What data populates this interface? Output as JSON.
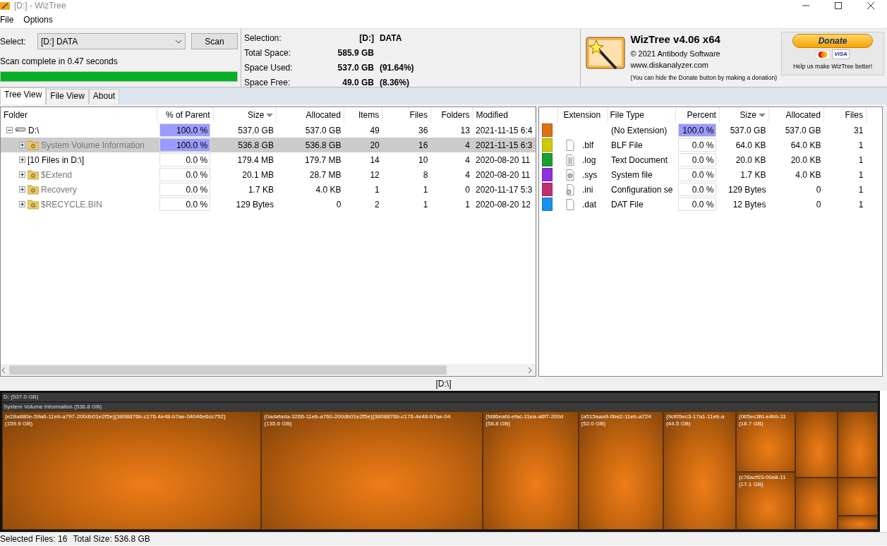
{
  "window": {
    "title": "[D:]  - WizTree"
  },
  "menu": [
    "File",
    "Options"
  ],
  "scan": {
    "select_label": "Select:",
    "drive": "[D:] DATA",
    "button": "Scan",
    "status": "Scan complete in 0.47 seconds",
    "level": 1.0
  },
  "summary": [
    {
      "label": "Selection:",
      "value": "[D:]",
      "extra": "DATA"
    },
    {
      "label": "Total Space:",
      "value": "585.9 GB"
    },
    {
      "label": "Space Used:",
      "value": "537.0 GB",
      "extra": "(91.64%)"
    },
    {
      "label": "Space Free:",
      "value": "49.0 GB",
      "extra": "(8.36%)"
    }
  ],
  "about": {
    "title": "WizTree v4.06 x64",
    "copyright": "© 2021 Antibody Software",
    "url": "www.diskanalyzer.com",
    "hint": "(You can hide the Donate button by making a donation)"
  },
  "donate": {
    "label": "Donate",
    "card_text": "VISA",
    "note": "Help us make WizTree better!"
  },
  "tabs": [
    {
      "label": "Tree View",
      "selected": true
    },
    {
      "label": "File View",
      "selected": false
    },
    {
      "label": "About",
      "selected": false
    }
  ],
  "tree": {
    "columns": [
      {
        "label": "Folder",
        "sorted": false
      },
      {
        "label": "% of Parent",
        "sorted": false
      },
      {
        "label": "Size",
        "sorted": true
      },
      {
        "label": "Allocated",
        "sorted": false
      },
      {
        "label": "Items",
        "sorted": false
      },
      {
        "label": "Files",
        "sorted": false
      },
      {
        "label": "Folders",
        "sorted": false
      },
      {
        "label": "Modified",
        "sorted": false
      }
    ],
    "rows": [
      {
        "kind": "drive",
        "name": "D:\\",
        "expanded": true,
        "system": false,
        "selected": false,
        "percent": "100.0 %",
        "level": 1.0,
        "size": "537.0 GB",
        "allocated": "537.0 GB",
        "items": "49",
        "files": "36",
        "folders": "13",
        "modified": "2021-11-15 6:4",
        "children": [
          {
            "kind": "folder",
            "name": "System Volume Information",
            "expanded": false,
            "system": true,
            "selected": true,
            "percent": "100.0 %",
            "level": 1.0,
            "size": "536.8 GB",
            "allocated": "536.8 GB",
            "items": "20",
            "files": "16",
            "folders": "4",
            "modified": "2021-11-15 6:3"
          },
          {
            "kind": "files",
            "name": "[10 Files in D:\\]",
            "expanded": false,
            "system": false,
            "selected": false,
            "percent": "0.0 %",
            "level": 0.0,
            "size": "179.4 MB",
            "allocated": "179.7 MB",
            "items": "14",
            "files": "10",
            "folders": "4",
            "modified": "2020-08-20 11"
          },
          {
            "kind": "folder",
            "name": "$Extend",
            "expanded": false,
            "system": true,
            "selected": false,
            "percent": "0.0 %",
            "level": 0.0,
            "size": "20.1 MB",
            "allocated": "28.7 MB",
            "items": "12",
            "files": "8",
            "folders": "4",
            "modified": "2020-08-20 11"
          },
          {
            "kind": "folder",
            "name": "Recovery",
            "expanded": false,
            "system": true,
            "selected": false,
            "percent": "0.0 %",
            "level": 0.0,
            "size": "1.7 KB",
            "allocated": "4.0 KB",
            "items": "1",
            "files": "1",
            "folders": "0",
            "modified": "2020-11-17 5:3"
          },
          {
            "kind": "folder",
            "name": "$RECYCLE.BIN",
            "expanded": false,
            "system": true,
            "selected": false,
            "percent": "0.0 %",
            "level": 0.0,
            "size": "129 Bytes",
            "allocated": "0",
            "items": "2",
            "files": "1",
            "folders": "1",
            "modified": "2020-08-20 12"
          }
        ]
      }
    ]
  },
  "extensions": {
    "columns": [
      {
        "label": "Extension",
        "sorted": false
      },
      {
        "label": "File Type",
        "sorted": false
      },
      {
        "label": "Percent",
        "sorted": false
      },
      {
        "label": "Size",
        "sorted": true
      },
      {
        "label": "Allocated",
        "sorted": false
      },
      {
        "label": "Files",
        "sorted": false
      }
    ],
    "rows": [
      {
        "kind": "none",
        "color": "#e07010",
        "file_type": "(No Extension)",
        "percent": "100.0 %",
        "level": 1.0,
        "size": "537.0 GB",
        "allocated": "537.0 GB",
        "files": "31"
      },
      {
        "kind": "blank",
        "color": "#cccc00",
        "extension": ".blf",
        "file_type": "BLF File",
        "percent": "0.0 %",
        "level": 0.0,
        "size": "64.0 KB",
        "allocated": "64.0 KB",
        "files": "1"
      },
      {
        "kind": "text",
        "color": "#18a030",
        "extension": ".log",
        "file_type": "Text Document",
        "percent": "0.0 %",
        "level": 0.0,
        "size": "20.0 KB",
        "allocated": "20.0 KB",
        "files": "1"
      },
      {
        "kind": "system",
        "color": "#9030e0",
        "extension": ".sys",
        "file_type": "System file",
        "percent": "0.0 %",
        "level": 0.0,
        "size": "1.7 KB",
        "allocated": "4.0 KB",
        "files": "1"
      },
      {
        "kind": "config",
        "color": "#c03070",
        "extension": ".ini",
        "file_type": "Configuration se",
        "percent": "0.0 %",
        "level": 0.0,
        "size": "129 Bytes",
        "allocated": "0",
        "files": "1"
      },
      {
        "kind": "blank",
        "color": "#1890f0",
        "extension": ".dat",
        "file_type": "DAT File",
        "percent": "0.0 %",
        "level": 0.0,
        "size": "12 Bytes",
        "allocated": "0",
        "files": "1"
      }
    ]
  },
  "path": "[D:\\]",
  "treemap": {
    "root": "D: (537.0 GB)",
    "folder": "System Volume Information (536.8 GB)",
    "tiles": [
      {
        "label": "{e28a880e-59a6-11eb-a797-200db01e2f5e}{3808876b-c176-4e48-b7ae-04046e6cc752}",
        "size": "(159.9 GB)"
      },
      {
        "label": "{0adafada-3266-11eb-a760-200db01e2f5e}{3808876b-c176-4e48-b7ae-04",
        "size": "(135.6 GB)"
      },
      {
        "label": "{fd86eafd-efac-11ea-a6f7-200d",
        "size": "(58.8 GB)"
      },
      {
        "label": "{a515aaa9-0be2-11eb-a724",
        "size": "(52.0 GB)"
      },
      {
        "label": "{9cf05ec3-17a1-11eb-a",
        "size": "(44.5 GB)"
      },
      {
        "label": "{065ec3fd-e4bb-11",
        "size": "(18.7 GB)"
      },
      {
        "label": "{c78acf03-00e8-11",
        "size": "(17.1 GB)"
      }
    ]
  },
  "status_bar": {
    "selected_files": "Selected Files: 16",
    "total_size": "Total Size: 536.8 GB"
  }
}
